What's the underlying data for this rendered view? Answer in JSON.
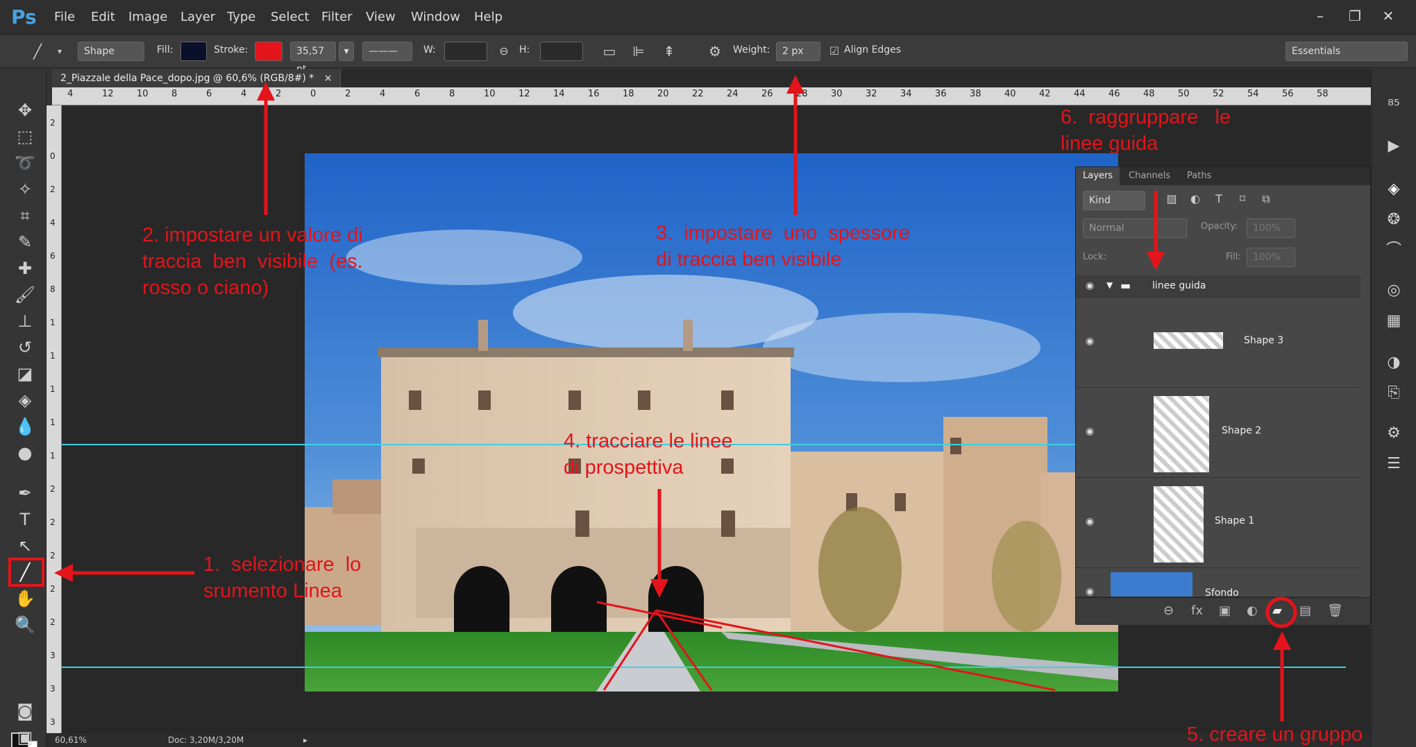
{
  "app": {
    "logo": "Ps"
  },
  "menu": [
    "File",
    "Edit",
    "Image",
    "Layer",
    "Type",
    "Select",
    "Filter",
    "View",
    "Window",
    "Help"
  ],
  "options": {
    "mode": "Shape",
    "fill_label": "Fill:",
    "stroke_label": "Stroke:",
    "stroke_width": "35,57 pt",
    "w_label": "W:",
    "h_label": "H:",
    "weight_label": "Weight:",
    "weight_value": "2 px",
    "align_edges": "Align Edges",
    "workspace": "Essentials",
    "fill_color": "#0a0f2a",
    "stroke_color": "#e3141b"
  },
  "document": {
    "tab_title": "2_Piazzale della Pace_dopo.jpg @ 60,6% (RGB/8#) *",
    "close": "×"
  },
  "ruler_top": [
    "4",
    "12",
    "10",
    "8",
    "6",
    "4",
    "2",
    "0",
    "2",
    "4",
    "6",
    "8",
    "10",
    "12",
    "14",
    "16",
    "18",
    "20",
    "22",
    "24",
    "26",
    "28",
    "30",
    "32",
    "34",
    "36",
    "38",
    "40",
    "42",
    "44",
    "46",
    "48",
    "50",
    "52",
    "54",
    "56",
    "58"
  ],
  "ruler_left": [
    "2",
    "0",
    "2",
    "4",
    "6",
    "8",
    "1",
    "1",
    "1",
    "1",
    "1",
    "2",
    "2",
    "2",
    "2",
    "2",
    "3",
    "3",
    "3"
  ],
  "layers_panel": {
    "tabs": [
      "Layers",
      "Channels",
      "Paths"
    ],
    "kind": "Kind",
    "blend": "Normal",
    "opacity_label": "Opacity:",
    "opacity_value": "100%",
    "lock_label": "Lock:",
    "fill_label": "Fill:",
    "fill_value": "100%",
    "group": "linee guida",
    "layers": [
      "Shape 3",
      "Shape 2",
      "Shape 1",
      "Sfondo"
    ]
  },
  "status": {
    "zoom": "60,61%",
    "doc": "Doc: 3,20M/3,20M"
  },
  "annotations": {
    "a1": "1.  selezionare  lo\nsrumento Linea",
    "a2": "2. impostare un valore di\ntraccia  ben  visibile  (es.\nrosso o ciano)",
    "a3": "3.  impostare  uno  spessore\ndi traccia ben visibile",
    "a4": "4. tracciare le linee\ndi prospettiva",
    "a5": "5. creare un gruppo",
    "a6": "6.  raggruppare   le\nlinee guida"
  },
  "colors": {
    "annotation": "#e3141b",
    "guide": "#3fd0e0",
    "ps_blue": "#4a9fe0"
  }
}
